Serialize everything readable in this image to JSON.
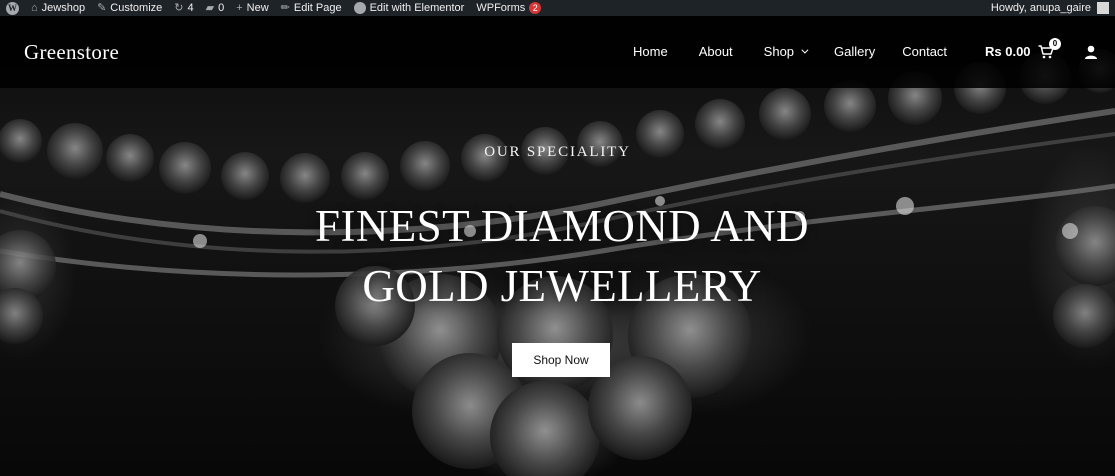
{
  "admin_bar": {
    "site_name": "Jewshop",
    "customize": "Customize",
    "updates_count": "4",
    "comments_count": "0",
    "new_label": "New",
    "edit_page": "Edit Page",
    "elementor_logo": "E",
    "edit_elementor": "Edit with Elementor",
    "wpforms": "WPForms",
    "wpforms_badge": "2",
    "howdy": "Howdy, anupa_gaire"
  },
  "header": {
    "logo": "Greenstore",
    "nav": {
      "home": "Home",
      "about": "About",
      "shop": "Shop",
      "gallery": "Gallery",
      "contact": "Contact"
    },
    "cart_total": "Rs 0.00",
    "cart_count": "0"
  },
  "hero": {
    "kicker": "OUR SPECIALITY",
    "headline_line1": "FINEST DIAMOND AND",
    "headline_line2": "GOLD JEWELLERY",
    "cta": "Shop Now"
  },
  "colors": {
    "admin_bar_bg": "#1d2327",
    "badge_red": "#d63638",
    "header_bg": "#000000",
    "button_bg": "#ffffff"
  },
  "icons": [
    "wordpress-logo-icon",
    "home-icon",
    "paintbrush-icon",
    "updates-icon",
    "comment-icon",
    "plus-icon",
    "pencil-icon",
    "elementor-icon",
    "cart-icon",
    "user-icon",
    "chevron-down-icon"
  ]
}
